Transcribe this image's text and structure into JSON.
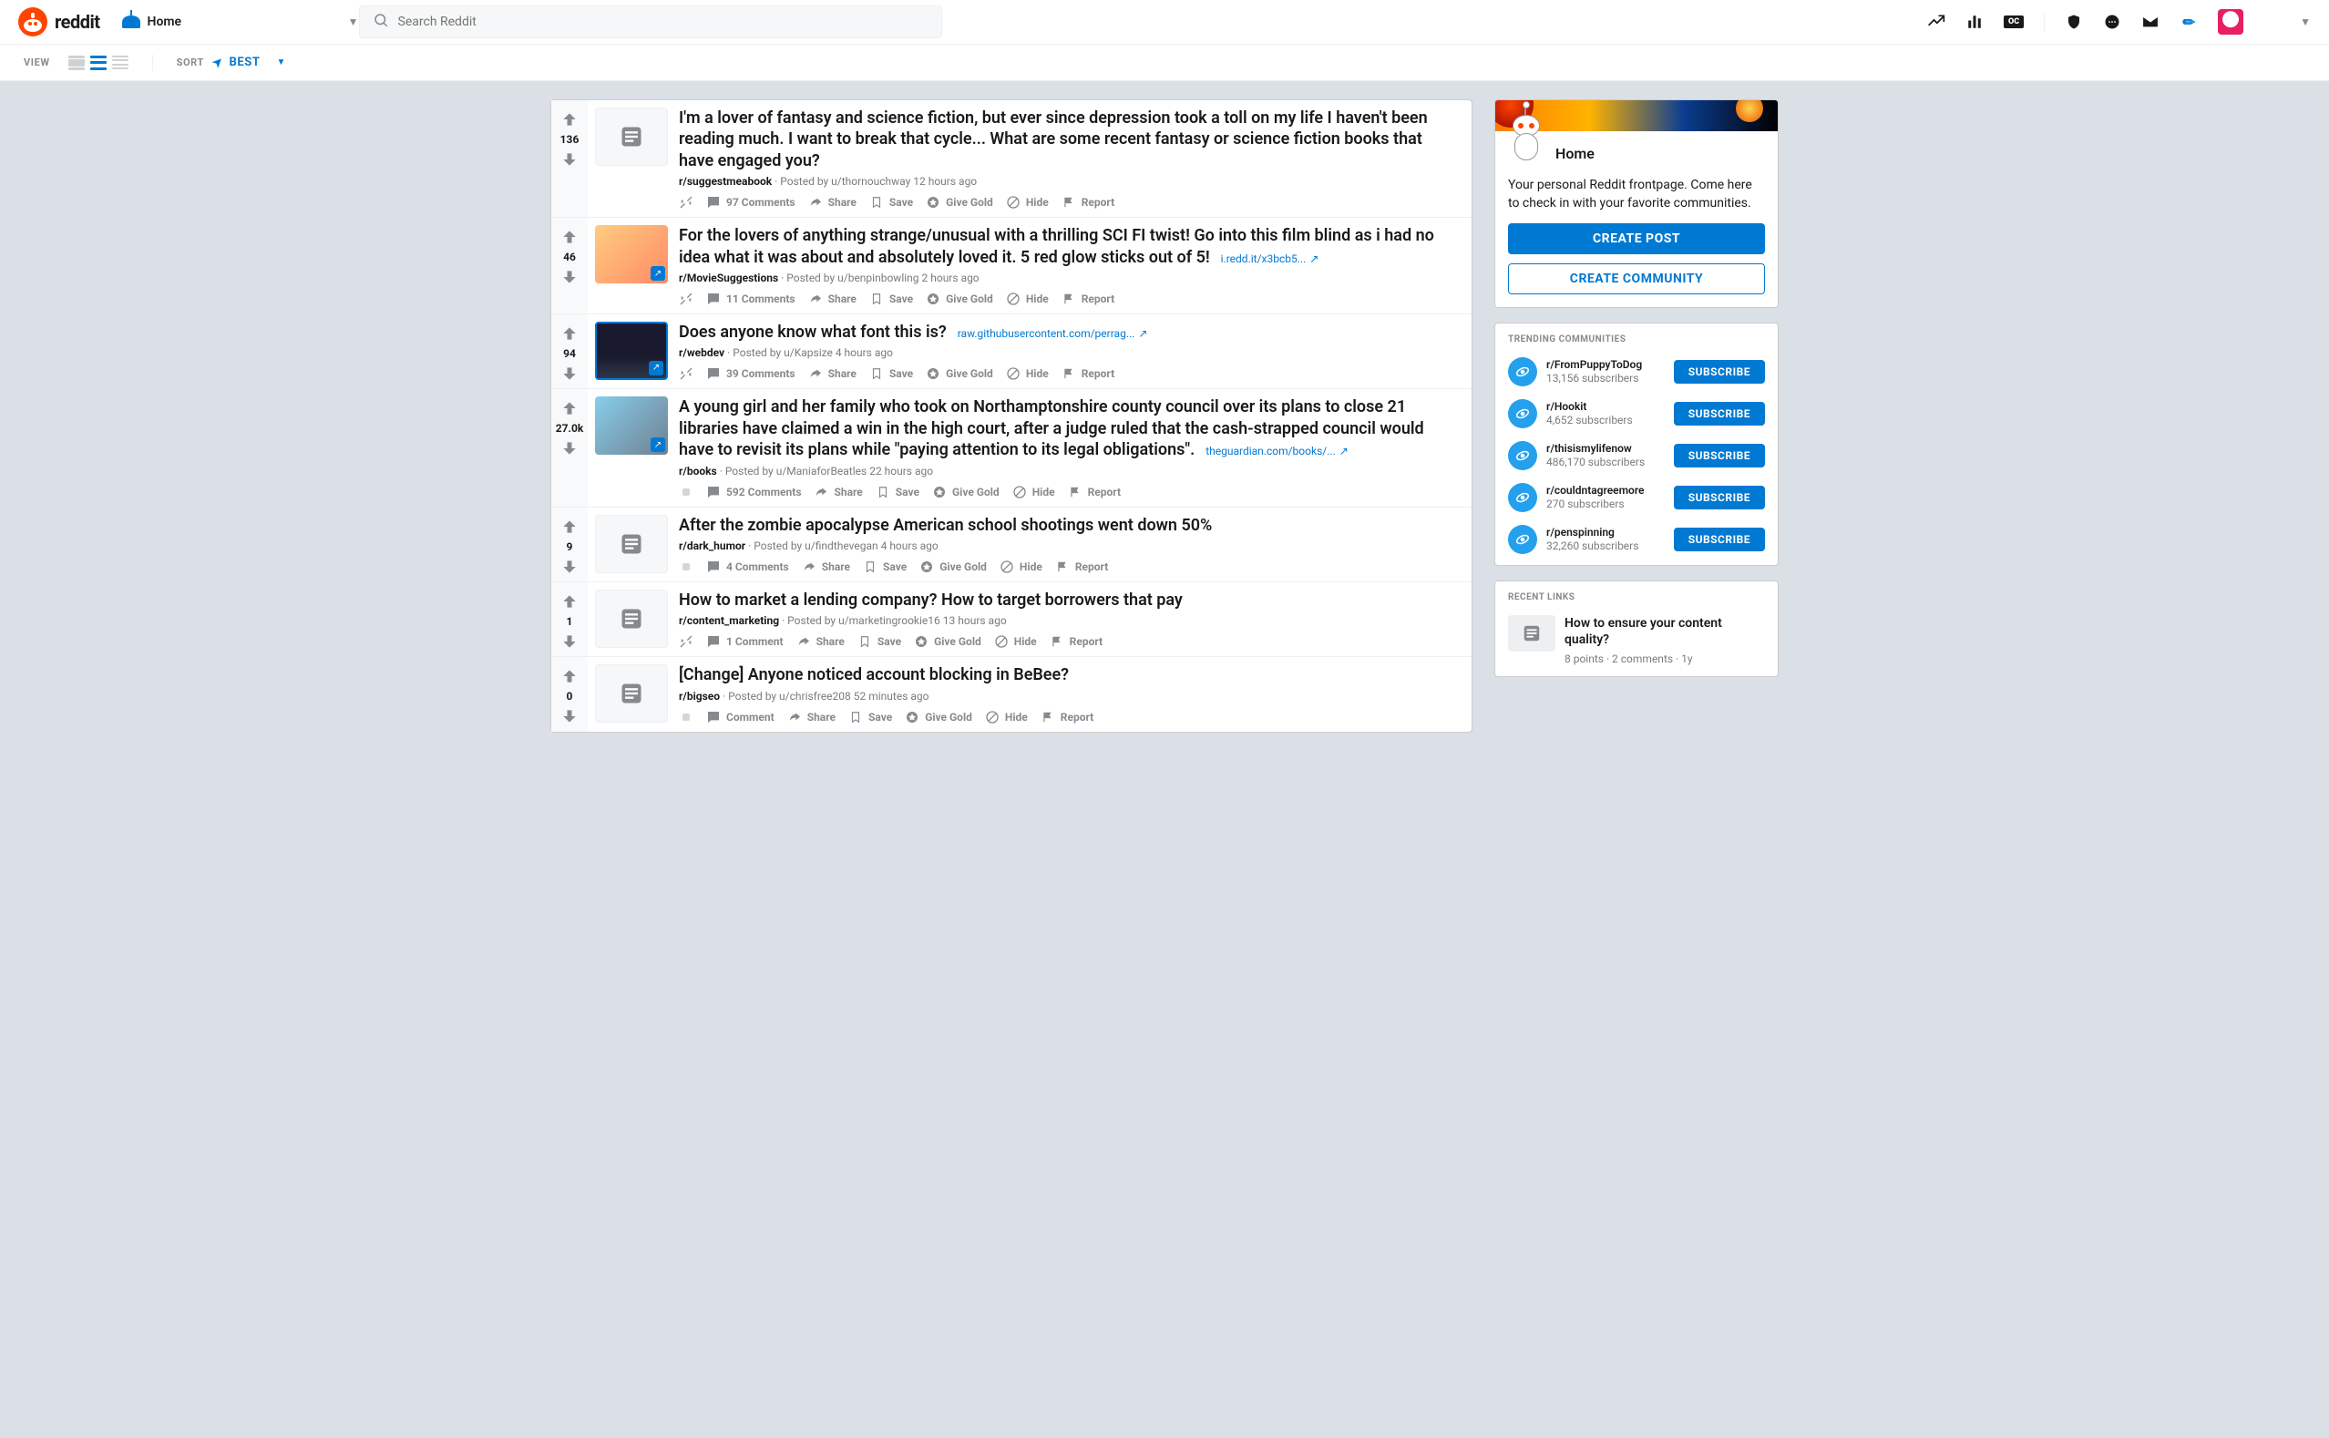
{
  "header": {
    "brand": "reddit",
    "nav_label": "Home",
    "search_placeholder": "Search Reddit"
  },
  "subheader": {
    "view_label": "VIEW",
    "sort_label": "SORT",
    "sort_value": "BEST"
  },
  "posts": [
    {
      "score": "136",
      "thumb": "text",
      "title": "I'm a lover of fantasy and science fiction, but ever since depression took a toll on my life I haven't been reading much. I want to break that cycle... What are some recent fantasy or science fiction books that have engaged you?",
      "subreddit": "r/suggestmeabook",
      "author": "u/thornouchway",
      "time": "12 hours ago",
      "comments": "97 Comments",
      "external": null,
      "expand_kind": "arrows"
    },
    {
      "score": "46",
      "thumb": "img1",
      "title": "For the lovers of anything strange/unusual with a thrilling SCI FI twist! Go into this film blind as i had no idea what it was about and absolutely loved it. 5 red glow sticks out of 5!",
      "subreddit": "r/MovieSuggestions",
      "author": "u/benpinbowling",
      "time": "2 hours ago",
      "comments": "11 Comments",
      "external": "i.redd.it/x3bcb5...",
      "expand_kind": "arrows"
    },
    {
      "score": "94",
      "thumb": "img2",
      "title": "Does anyone know what font this is?",
      "subreddit": "r/webdev",
      "author": "u/Kapsize",
      "time": "4 hours ago",
      "comments": "39 Comments",
      "external": "raw.githubusercontent.com/perrag...",
      "expand_kind": "arrows"
    },
    {
      "score": "27.0k",
      "thumb": "img3",
      "title": "A young girl and her family who took on Northamptonshire county council over its plans to close 21 libraries have claimed a win in the high court, after a judge ruled that the cash-strapped council would have to revisit its plans while \"paying attention to its legal obligations\".",
      "subreddit": "r/books",
      "author": "u/ManiaforBeatles",
      "time": "22 hours ago",
      "comments": "592 Comments",
      "external": "theguardian.com/books/...",
      "expand_kind": "dot"
    },
    {
      "score": "9",
      "thumb": "text",
      "title": "After the zombie apocalypse American school shootings went down 50%",
      "subreddit": "r/dark_humor",
      "author": "u/findthevegan",
      "time": "4 hours ago",
      "comments": "4 Comments",
      "external": null,
      "expand_kind": "dot"
    },
    {
      "score": "1",
      "thumb": "text",
      "title": "How to market a lending company? How to target borrowers that pay",
      "subreddit": "r/content_marketing",
      "author": "u/marketingrookie16",
      "time": "13 hours ago",
      "comments": "1 Comment",
      "external": null,
      "expand_kind": "arrows"
    },
    {
      "score": "0",
      "thumb": "text",
      "title": "[Change] Anyone noticed account blocking in BeBee?",
      "subreddit": "r/bigseo",
      "author": "u/chrisfree208",
      "time": "52 minutes ago",
      "comments": "Comment",
      "external": null,
      "expand_kind": "dot"
    }
  ],
  "actions": {
    "share": "Share",
    "save": "Save",
    "gold": "Give Gold",
    "hide": "Hide",
    "report": "Report"
  },
  "meta_prefix": "Posted by",
  "sidebar": {
    "home_title": "Home",
    "home_desc": "Your personal Reddit frontpage. Come here to check in with your favorite communities.",
    "create_post": "CREATE POST",
    "create_community": "CREATE COMMUNITY",
    "trending_title": "TRENDING COMMUNITIES",
    "subscribe": "SUBSCRIBE",
    "communities": [
      {
        "name": "r/FromPuppyToDog",
        "subs": "13,156 subscribers"
      },
      {
        "name": "r/Hookit",
        "subs": "4,652 subscribers"
      },
      {
        "name": "r/thisismylifenow",
        "subs": "486,170 subscribers"
      },
      {
        "name": "r/couldntagreemore",
        "subs": "270 subscribers"
      },
      {
        "name": "r/penspinning",
        "subs": "32,260 subscribers"
      }
    ],
    "recent_title": "RECENT LINKS",
    "recent": {
      "title": "How to ensure your content quality?",
      "meta": "8 points · 2 comments · 1y"
    }
  }
}
